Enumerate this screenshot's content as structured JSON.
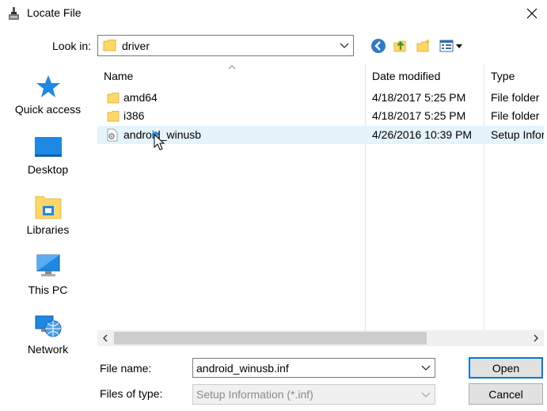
{
  "window": {
    "title": "Locate File"
  },
  "lookin": {
    "label": "Look in:",
    "value": "driver"
  },
  "toolbar": {
    "back_icon": "back-arrow-icon",
    "up_icon": "up-folder-icon",
    "new_folder_icon": "new-folder-icon",
    "views_icon": "view-menu-icon"
  },
  "places": [
    {
      "label": "Quick access",
      "icon": "star-icon"
    },
    {
      "label": "Desktop",
      "icon": "desktop-icon"
    },
    {
      "label": "Libraries",
      "icon": "libraries-icon"
    },
    {
      "label": "This PC",
      "icon": "computer-icon"
    },
    {
      "label": "Network",
      "icon": "network-icon"
    }
  ],
  "files": {
    "columns": [
      "Name",
      "Date modified",
      "Type"
    ],
    "rows": [
      {
        "name": "amd64",
        "date": "4/18/2017 5:25 PM",
        "type": "File folder",
        "kind": "folder"
      },
      {
        "name": "i386",
        "date": "4/18/2017 5:25 PM",
        "type": "File folder",
        "kind": "folder"
      },
      {
        "name": "android_winusb",
        "date": "4/26/2016 10:39 PM",
        "type": "Setup Information",
        "kind": "inf",
        "selected": true
      }
    ]
  },
  "filename": {
    "label": "File name:",
    "value": "android_winusb.inf"
  },
  "filetype": {
    "label": "Files of type:",
    "value": "Setup Information (*.inf)"
  },
  "buttons": {
    "open": "Open",
    "cancel": "Cancel"
  },
  "colors": {
    "accent": "#0078d7",
    "selection": "#e5f3fb",
    "folder": "#ffd766"
  }
}
